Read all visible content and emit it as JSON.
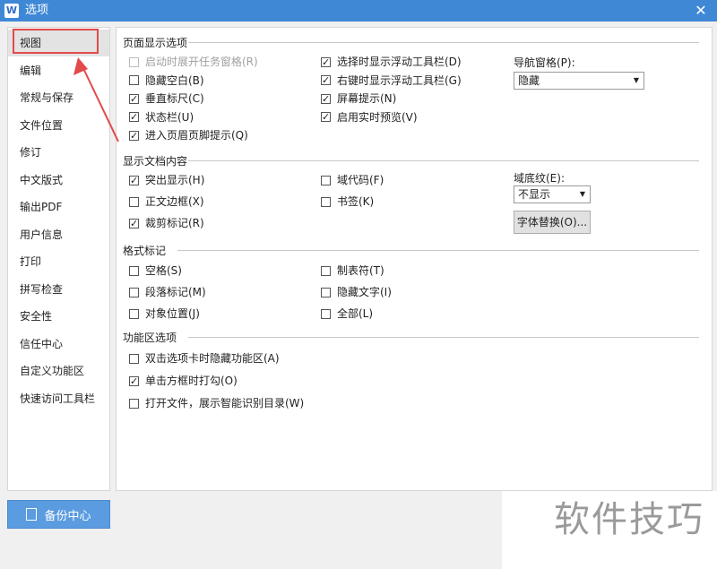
{
  "window": {
    "title": "选项",
    "app_icon": "W",
    "close_symbol": "✕"
  },
  "sidebar": {
    "items": [
      {
        "label": "视图"
      },
      {
        "label": "编辑"
      },
      {
        "label": "常规与保存"
      },
      {
        "label": "文件位置"
      },
      {
        "label": "修订"
      },
      {
        "label": "中文版式"
      },
      {
        "label": "输出PDF"
      },
      {
        "label": "用户信息"
      },
      {
        "label": "打印"
      },
      {
        "label": "拼写检查"
      },
      {
        "label": "安全性"
      },
      {
        "label": "信任中心"
      },
      {
        "label": "自定义功能区"
      },
      {
        "label": "快速访问工具栏"
      }
    ],
    "selected_index": 0
  },
  "page_display": {
    "heading": "页面显示选项",
    "left": [
      {
        "label": "启动时展开任务窗格(R)",
        "checked": false,
        "disabled": true
      },
      {
        "label": "隐藏空白(B)",
        "checked": false
      },
      {
        "label": "垂直标尺(C)",
        "checked": true
      },
      {
        "label": "状态栏(U)",
        "checked": true
      },
      {
        "label": "进入页眉页脚提示(Q)",
        "checked": true
      }
    ],
    "right": [
      {
        "label": "选择时显示浮动工具栏(D)",
        "checked": true
      },
      {
        "label": "右键时显示浮动工具栏(G)",
        "checked": true
      },
      {
        "label": "屏幕提示(N)",
        "checked": true
      },
      {
        "label": "启用实时预览(V)",
        "checked": true
      }
    ],
    "nav_pane_label": "导航窗格(P):",
    "nav_pane_value": "隐藏"
  },
  "doc_content": {
    "heading": "显示文档内容",
    "left": [
      {
        "label": "突出显示(H)",
        "checked": true
      },
      {
        "label": "正文边框(X)",
        "checked": false
      },
      {
        "label": "裁剪标记(R)",
        "checked": true
      }
    ],
    "right": [
      {
        "label": "域代码(F)",
        "checked": false
      },
      {
        "label": "书签(K)",
        "checked": false
      }
    ],
    "field_shading_label": "域底纹(E):",
    "field_shading_value": "不显示",
    "font_substitute_button": "字体替换(O)..."
  },
  "format_marks": {
    "heading": "格式标记",
    "left": [
      {
        "label": "空格(S)",
        "checked": false
      },
      {
        "label": "段落标记(M)",
        "checked": false
      },
      {
        "label": "对象位置(J)",
        "checked": false
      }
    ],
    "right": [
      {
        "label": "制表符(T)",
        "checked": false
      },
      {
        "label": "隐藏文字(I)",
        "checked": false
      },
      {
        "label": "全部(L)",
        "checked": false
      }
    ]
  },
  "ribbon": {
    "heading": "功能区选项",
    "items": [
      {
        "label": "双击选项卡时隐藏功能区(A)",
        "checked": false
      },
      {
        "label": "单击方框时打勾(O)",
        "checked": true
      },
      {
        "label": "打开文件，展示智能识别目录(W)",
        "checked": false
      }
    ]
  },
  "backup_button": "备份中心",
  "watermark": "软件技巧",
  "colors": {
    "titlebar": "#3f88d6",
    "highlight": "#e34a4a",
    "backup": "#5b9ce0"
  }
}
